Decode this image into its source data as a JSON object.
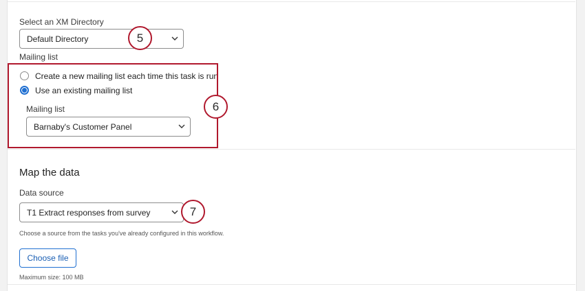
{
  "directory": {
    "label": "Select an XM Directory",
    "selected": "Default Directory"
  },
  "mailing_list": {
    "section_label": "Mailing list",
    "options": [
      {
        "label": "Create a new mailing list each time this task is run",
        "checked": false
      },
      {
        "label": "Use an existing mailing list",
        "checked": true
      }
    ],
    "sub_label": "Mailing list",
    "selected": "Barnaby's Customer Panel"
  },
  "map_data": {
    "heading": "Map the data",
    "source_label": "Data source",
    "source_selected": "T1 Extract responses from survey",
    "help_text": "Choose a source from the tasks you've already configured in this workflow.",
    "choose_file_label": "Choose file",
    "max_size_text": "Maximum size: 100 MB"
  },
  "callouts": [
    "5",
    "6",
    "7"
  ],
  "colors": {
    "accent": "#1f6fd1",
    "callout_border": "#b0182d"
  }
}
